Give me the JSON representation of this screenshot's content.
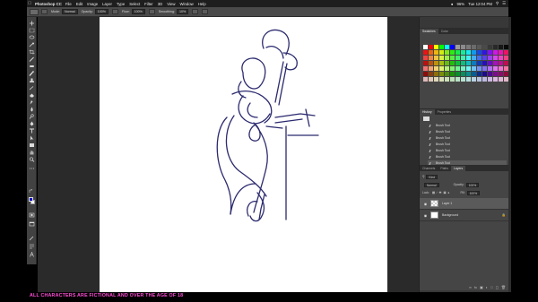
{
  "menubar": {
    "apple_icon": "apple-icon",
    "app_name": "Photoshop CC",
    "menus": [
      "File",
      "Edit",
      "Image",
      "Layer",
      "Type",
      "Select",
      "Filter",
      "3D",
      "View",
      "Window",
      "Help"
    ],
    "battery": "96%",
    "time": "Tue 12:04 PM"
  },
  "options": {
    "mode_label": "Mode:",
    "mode_value": "Normal",
    "opacity_label": "Opacity:",
    "opacity_value": "100%",
    "flow_label": "Flow:",
    "flow_value": "100%",
    "smoothing_label": "Smoothing:",
    "smoothing_value": "10%"
  },
  "colors": {
    "foreground": "#0d0cc8",
    "background": "#ffffff",
    "sketch_stroke": "#2b2a6e"
  },
  "panels": {
    "swatches_tabs": [
      "Swatches",
      "Color"
    ],
    "history_tabs": [
      "History",
      "Properties"
    ],
    "history_items": [
      "Brush Tool",
      "Brush Tool",
      "Brush Tool",
      "Brush Tool",
      "Brush Tool",
      "Brush Tool",
      "Brush Tool"
    ],
    "layers_tabs": [
      "Channels",
      "Paths",
      "Layers"
    ],
    "layers": {
      "filter_kind": "Kind",
      "blend_mode": "Normal",
      "opacity_label": "Opacity:",
      "opacity_value": "100%",
      "lock_label": "Lock:",
      "fill_label": "Fill:",
      "fill_value": "100%",
      "items": [
        {
          "name": "Layer 1"
        },
        {
          "name": "Background"
        }
      ]
    }
  },
  "caption": "ALL CHARACTERS ARE FICTIONAL AND OVER THE AGE OF 18"
}
